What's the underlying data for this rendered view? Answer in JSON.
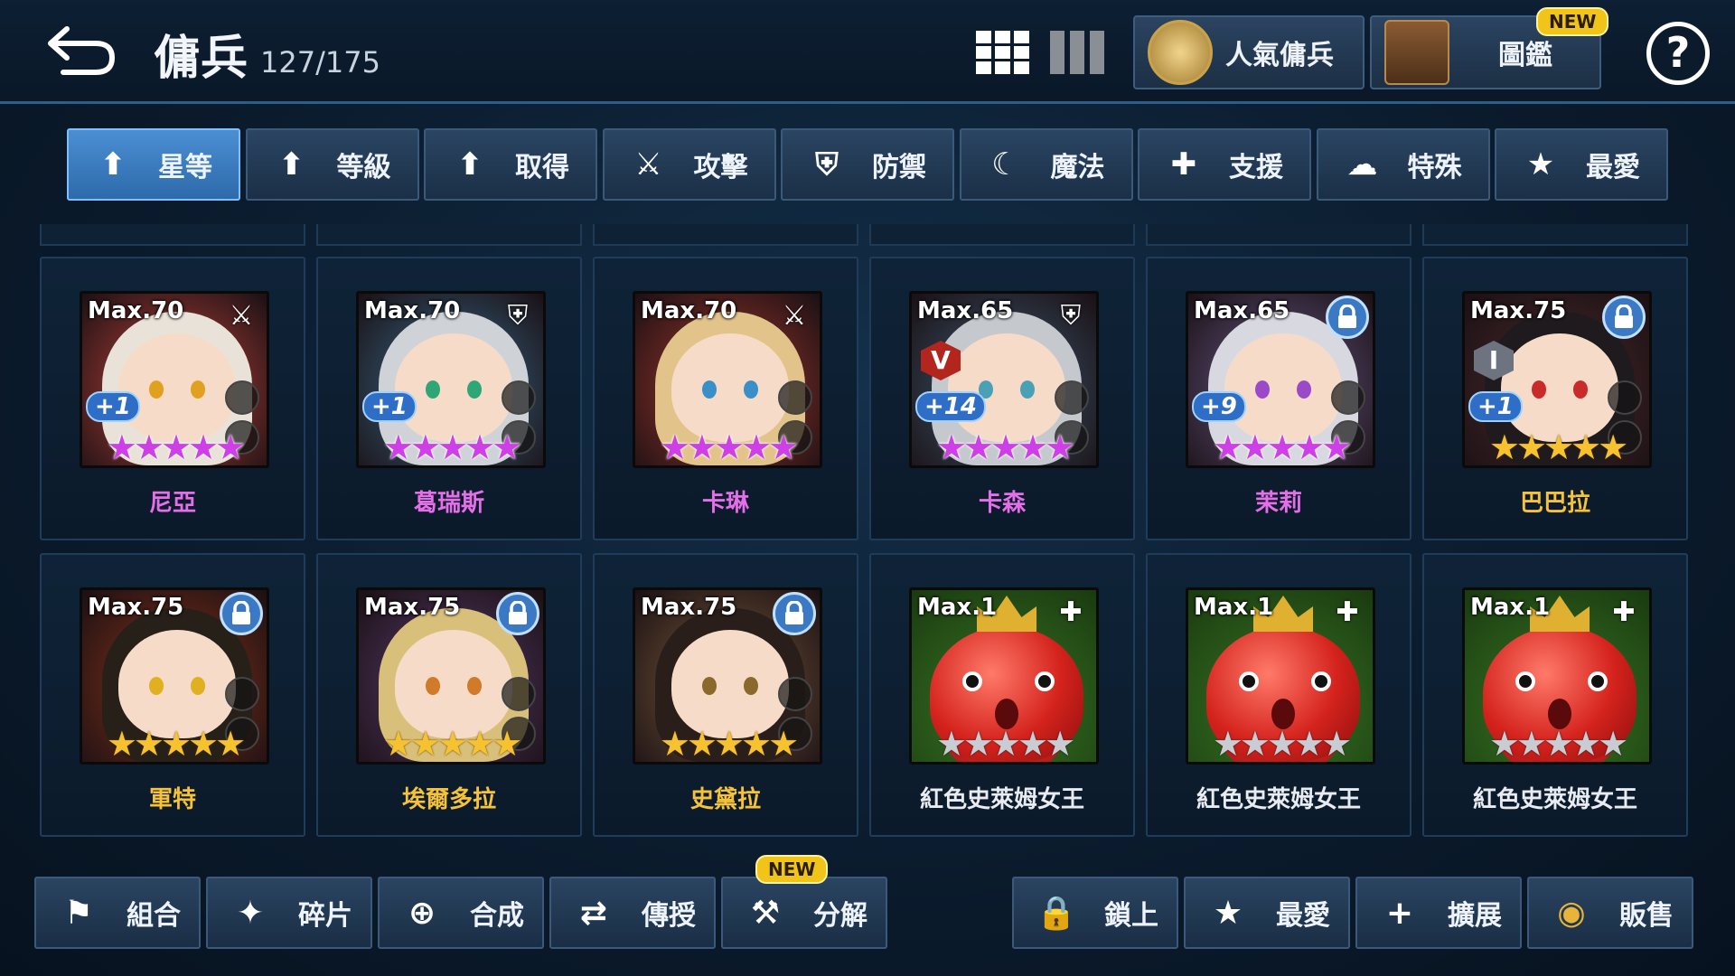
{
  "header": {
    "title": "傭兵",
    "count": "127/175",
    "popular_label": "人氣傭兵",
    "codex_label": "圖鑑",
    "new_badge": "NEW",
    "help_label": "?"
  },
  "tabs": [
    {
      "label": "星等",
      "icon": "arrow-up-icon",
      "active": true
    },
    {
      "label": "等級",
      "icon": "arrow-up-icon",
      "active": false
    },
    {
      "label": "取得",
      "icon": "arrow-up-icon",
      "active": false
    },
    {
      "label": "攻擊",
      "icon": "sword-icon",
      "active": false
    },
    {
      "label": "防禦",
      "icon": "shield-icon",
      "active": false
    },
    {
      "label": "魔法",
      "icon": "magic-hat-icon",
      "active": false
    },
    {
      "label": "支援",
      "icon": "support-icon",
      "active": false
    },
    {
      "label": "特殊",
      "icon": "cloud-icon",
      "active": false
    },
    {
      "label": "最愛",
      "icon": "star-icon",
      "active": false
    }
  ],
  "cards": [
    {
      "name": "尼亞",
      "max": "Max.70",
      "plus": "+1",
      "stars": "★★★★★",
      "star_color": "purple",
      "name_color": "#e46fe9",
      "role": "sword-icon",
      "locked": false,
      "bg": "#c4453c",
      "hair": "#e8e2d8",
      "eye": "#e0a020"
    },
    {
      "name": "葛瑞斯",
      "max": "Max.70",
      "plus": "+1",
      "stars": "★★★★★",
      "star_color": "purple",
      "name_color": "#e46fe9",
      "role": "shield-icon",
      "locked": false,
      "bg": "#3a6c8c",
      "hair": "#cfd3d8",
      "eye": "#2ea676"
    },
    {
      "name": "卡琳",
      "max": "Max.70",
      "plus": "",
      "stars": "★★★★★",
      "star_color": "purple",
      "name_color": "#e46fe9",
      "role": "sword-icon",
      "locked": false,
      "bg": "#a6382c",
      "hair": "#e2c48a",
      "eye": "#3a8fc9"
    },
    {
      "name": "卡森",
      "max": "Max.65",
      "plus": "+14",
      "rank": "V",
      "stars": "★★★★★",
      "star_color": "purple",
      "name_color": "#e46fe9",
      "role": "shield-icon",
      "locked": false,
      "bg": "#3d5a72",
      "hair": "#c5c9ce",
      "eye": "#4aa0b5"
    },
    {
      "name": "茉莉",
      "max": "Max.65",
      "plus": "+9",
      "stars": "★★★★★",
      "star_color": "purple",
      "name_color": "#e46fe9",
      "role": "",
      "locked": true,
      "bg": "#6a5a8a",
      "hair": "#d8d8e0",
      "eye": "#9a4ac9"
    },
    {
      "name": "巴巴拉",
      "max": "Max.75",
      "plus": "+1",
      "rank": "I",
      "stars": "★★★★★",
      "star_color": "gold",
      "name_color": "#f5c23a",
      "role": "",
      "locked": true,
      "bg": "#4a2a2a",
      "hair": "#1e1a1e",
      "eye": "#c92a2a"
    },
    {
      "name": "軍特",
      "max": "Max.75",
      "plus": "",
      "stars": "★★★★★",
      "star_color": "gold",
      "name_color": "#f5c23a",
      "role": "",
      "locked": true,
      "bg": "#8a3318",
      "hair": "#262019",
      "eye": "#e0b020"
    },
    {
      "name": "埃爾多拉",
      "max": "Max.75",
      "plus": "",
      "stars": "★★★★★",
      "star_color": "gold",
      "name_color": "#f5c23a",
      "role": "",
      "locked": true,
      "bg": "#5a3c6e",
      "hair": "#d9c07a",
      "eye": "#d07a2a"
    },
    {
      "name": "史黛拉",
      "max": "Max.75",
      "plus": "",
      "stars": "★★★★★",
      "star_color": "gold",
      "name_color": "#f5c23a",
      "role": "",
      "locked": true,
      "bg": "#7a5a3a",
      "hair": "#2a1e1a",
      "eye": "#8a6a2a"
    },
    {
      "name": "紅色史萊姆女王",
      "max": "Max.1",
      "plus": "",
      "stars": "★★★★★",
      "star_color": "silver",
      "name_color": "#e8ebf0",
      "role": "support-icon",
      "locked": false,
      "slime": true
    },
    {
      "name": "紅色史萊姆女王",
      "max": "Max.1",
      "plus": "",
      "stars": "★★★★★",
      "star_color": "silver",
      "name_color": "#e8ebf0",
      "role": "support-icon",
      "locked": false,
      "slime": true
    },
    {
      "name": "紅色史萊姆女王",
      "max": "Max.1",
      "plus": "",
      "stars": "★★★★★",
      "star_color": "silver",
      "name_color": "#e8ebf0",
      "role": "support-icon",
      "locked": false,
      "slime": true
    }
  ],
  "bottom": [
    {
      "label": "組合",
      "icon": "team-icon"
    },
    {
      "label": "碎片",
      "icon": "shards-icon"
    },
    {
      "label": "合成",
      "icon": "combine-icon"
    },
    {
      "label": "傳授",
      "icon": "transfer-icon"
    },
    {
      "label": "分解",
      "icon": "hammer-icon",
      "new": true
    },
    {
      "label": "鎖上",
      "icon": "lock-icon"
    },
    {
      "label": "最愛",
      "icon": "star-icon"
    },
    {
      "label": "擴展",
      "icon": "plus-icon"
    },
    {
      "label": "販售",
      "icon": "coin-icon"
    }
  ]
}
